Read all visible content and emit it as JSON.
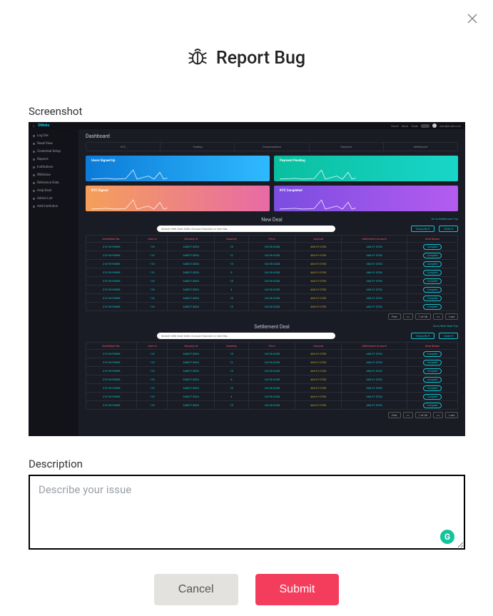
{
  "dialog": {
    "title": "Report Bug",
    "screenshot_label": "Screenshot",
    "description_label": "Description",
    "description_placeholder": "Describe your issue",
    "cancel_label": "Cancel",
    "submit_label": "Submit",
    "grammarly_badge": "G"
  },
  "dashboard": {
    "brand": "DMobo",
    "topbar_items": [
      "Home",
      "Send",
      "Trade"
    ],
    "user_email": "user@email.com",
    "title": "Dashboard",
    "sidebar": [
      "Log Out",
      "Read/View",
      "Credential Setup",
      "Reports",
      "Institutions",
      "Withdraw",
      "Reference Data",
      "Help Desk",
      "Admin List",
      "Add Institution"
    ],
    "tabs": [
      "KYC",
      "Trading",
      "Compensation",
      "Payment",
      "Settlement"
    ],
    "cards": [
      {
        "label": "Users Signed Up"
      },
      {
        "label": "Payment Pending"
      },
      {
        "label": "KYC Signed"
      },
      {
        "label": "KYC Completed"
      }
    ],
    "sections": [
      {
        "heading": "New Deal",
        "top_link": "Go to Settlement Top",
        "search_placeholder": "Search With Deal Seller Account Number or User Na...",
        "group_by": "Group By ▾",
        "order": "Order ▾",
        "columns": [
          "DealSheet No.",
          "User Id",
          "Security Id",
          "Quantity",
          "Price",
          "Amount",
          "Settlement Amount",
          "Deal Status"
        ],
        "rows": [
          [
            "213-93-93898",
            "110",
            "3400713533",
            "15",
            "143.90-4200",
            "468.91-0700",
            "468.91-0700",
            "Complete"
          ],
          [
            "213-93-93898",
            "110",
            "3400713533",
            "12",
            "143.90-4200",
            "468.91-0700",
            "468.91-0700",
            "Complete"
          ],
          [
            "213-93-93898",
            "110",
            "3400713533",
            "15",
            "143.90-4200",
            "468.91-0700",
            "468.91-0700",
            "Complete"
          ],
          [
            "213-93-93898",
            "110",
            "3400713533",
            "8",
            "143.90-4200",
            "468.91-0700",
            "468.91-0700",
            "Complete"
          ],
          [
            "213-93-93898",
            "110",
            "3400713533",
            "15",
            "143.90-4200",
            "468.91-0700",
            "468.91-0700",
            "Complete"
          ],
          [
            "213-93-93898",
            "110",
            "3400713533",
            "4",
            "143.90-4200",
            "468.91-0700",
            "468.91-0700",
            "Complete"
          ],
          [
            "213-93-93898",
            "110",
            "3400713533",
            "15",
            "143.90-4200",
            "468.91-0700",
            "468.91-0700",
            "Complete"
          ],
          [
            "213-93-93898",
            "110",
            "3400713533",
            "15",
            "143.90-4200",
            "468.91-0700",
            "468.91-0700",
            "Complete"
          ]
        ],
        "pager": {
          "first": "First",
          "prev": "<<",
          "info": "1 of 36",
          "next": ">>",
          "last": "Last"
        }
      },
      {
        "heading": "Settlement Deal",
        "top_link": "Go to New Deal Top",
        "search_placeholder": "Search With Deal Seller Account Number or User Na...",
        "group_by": "Group By ▾",
        "order": "Order ▾",
        "columns": [
          "DealSheet No.",
          "User Id",
          "Security Id",
          "Quantity",
          "Price",
          "Amount",
          "Settlement Amount",
          "Deal Status"
        ],
        "rows": [
          [
            "213-93-93898",
            "110",
            "3400713533",
            "15",
            "143.90-4200",
            "468.91-0700",
            "468.91-0700",
            "Complete"
          ],
          [
            "213-93-93898",
            "110",
            "3400713533",
            "12",
            "143.90-4200",
            "468.91-0700",
            "468.91-0700",
            "Complete"
          ],
          [
            "213-93-93898",
            "110",
            "3400713533",
            "15",
            "143.90-4200",
            "468.91-0700",
            "468.91-0700",
            "Complete"
          ],
          [
            "213-93-93898",
            "110",
            "3400713533",
            "8",
            "143.90-4200",
            "468.91-0700",
            "468.91-0700",
            "Complete"
          ],
          [
            "213-93-93898",
            "110",
            "3400713533",
            "15",
            "143.90-4200",
            "468.91-0700",
            "468.91-0700",
            "Complete"
          ],
          [
            "213-93-93898",
            "110",
            "3400713533",
            "4",
            "143.90-4200",
            "468.91-0700",
            "468.91-0700",
            "Complete"
          ],
          [
            "213-93-93898",
            "110",
            "3400713533",
            "15",
            "143.90-4200",
            "468.91-0700",
            "468.91-0700",
            "Complete"
          ]
        ],
        "pager": {
          "first": "First",
          "prev": "<<",
          "info": "1 of 36",
          "next": ">>",
          "last": "Last"
        }
      }
    ]
  }
}
